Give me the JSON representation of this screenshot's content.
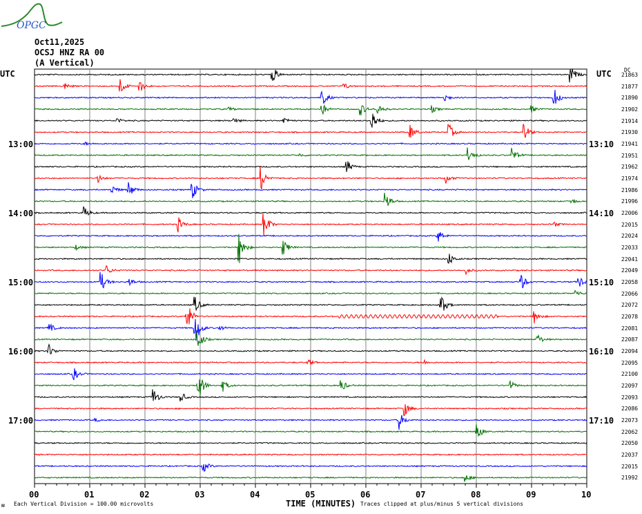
{
  "logo": {
    "text": "OPGC"
  },
  "header": {
    "date": "Oct11,2025",
    "station": "OCSJ HNZ RA 00",
    "component": "(A Vertical)"
  },
  "left_axis_label": "UTC",
  "right_axis_label": "UTC",
  "dc_header": "DC",
  "footer": {
    "scale_note": "Each Vertical Division =  100.00 microvolts",
    "xlabel": "TIME (MINUTES)",
    "clip_note": "Traces clipped at plus/minus 5 vertical divisions",
    "corner_mark": "ᴍ"
  },
  "colors": {
    "trace_cycle": [
      "#000000",
      "#ff0000",
      "#0000ff",
      "#007000"
    ],
    "grid": "#808080"
  },
  "chart_data": {
    "type": "line",
    "title": "OCSJ HNZ RA 00 (A Vertical) helicorder, Oct11,2025",
    "xlabel": "TIME (MINUTES)",
    "xlim": [
      0,
      10
    ],
    "x_ticks": [
      "00",
      "01",
      "02",
      "03",
      "04",
      "05",
      "06",
      "07",
      "08",
      "09",
      "10"
    ],
    "rows": 36,
    "row_minutes": 10,
    "left_hour_labels": [
      {
        "row": 6,
        "label": "13:00"
      },
      {
        "row": 12,
        "label": "14:00"
      },
      {
        "row": 18,
        "label": "15:00"
      },
      {
        "row": 24,
        "label": "16:00"
      },
      {
        "row": 30,
        "label": "17:00"
      }
    ],
    "right_hour_labels": [
      {
        "row": 6,
        "label": "13:10"
      },
      {
        "row": 12,
        "label": "14:10"
      },
      {
        "row": 18,
        "label": "15:10"
      },
      {
        "row": 24,
        "label": "16:10"
      },
      {
        "row": 30,
        "label": "17:10"
      }
    ],
    "dc_offsets": [
      "21863",
      "21877",
      "21890",
      "21902",
      "21914",
      "21930",
      "21941",
      "21951",
      "21962",
      "21974",
      "21986",
      "21996",
      "22006",
      "22015",
      "22024",
      "22033",
      "22041",
      "22049",
      "22058",
      "22066",
      "22072",
      "22078",
      "22081",
      "22087",
      "22094",
      "22095",
      "22100",
      "22097",
      "22093",
      "22086",
      "22073",
      "22062",
      "22050",
      "22037",
      "22015",
      "21992"
    ],
    "events": [
      [
        0,
        4.3,
        1.2
      ],
      [
        0,
        9.7,
        1.2
      ],
      [
        1,
        1.55,
        1
      ],
      [
        1,
        1.9,
        0.8
      ],
      [
        1,
        0.55,
        0.4
      ],
      [
        1,
        5.6,
        0.4
      ],
      [
        2,
        5.2,
        1.2
      ],
      [
        2,
        7.4,
        0.7
      ],
      [
        2,
        9.4,
        1.3
      ],
      [
        3,
        5.2,
        0.8
      ],
      [
        3,
        5.9,
        0.8
      ],
      [
        3,
        6.2,
        0.9
      ],
      [
        3,
        3.5,
        0.3
      ],
      [
        3,
        7.2,
        0.4
      ],
      [
        3,
        9.0,
        0.4
      ],
      [
        4,
        6.1,
        1.6
      ],
      [
        4,
        4.5,
        0.5
      ],
      [
        4,
        1.5,
        0.3
      ],
      [
        4,
        3.6,
        0.4
      ],
      [
        5,
        6.8,
        1
      ],
      [
        5,
        7.5,
        1.1
      ],
      [
        5,
        8.85,
        1.3
      ],
      [
        6,
        0.9,
        0.2
      ],
      [
        7,
        7.85,
        1
      ],
      [
        7,
        8.65,
        0.9
      ],
      [
        7,
        4.8,
        0.2
      ],
      [
        8,
        5.65,
        0.9
      ],
      [
        9,
        1.15,
        0.5
      ],
      [
        9,
        7.45,
        0.6
      ],
      [
        9,
        4.1,
        1.5
      ],
      [
        10,
        1.7,
        1
      ],
      [
        10,
        2.85,
        1.3
      ],
      [
        10,
        1.4,
        0.6
      ],
      [
        11,
        6.35,
        1.3
      ],
      [
        11,
        9.7,
        0.4
      ],
      [
        12,
        0.9,
        0.7
      ],
      [
        13,
        2.6,
        0.9
      ],
      [
        13,
        4.15,
        1.8
      ],
      [
        13,
        9.4,
        0.3
      ],
      [
        14,
        7.3,
        0.9
      ],
      [
        15,
        3.7,
        2.2
      ],
      [
        15,
        4.5,
        1.1
      ],
      [
        15,
        0.75,
        0.3
      ],
      [
        16,
        7.5,
        0.8
      ],
      [
        17,
        1.3,
        0.6
      ],
      [
        17,
        7.8,
        0.5
      ],
      [
        18,
        1.2,
        1.3
      ],
      [
        18,
        1.7,
        0.6
      ],
      [
        18,
        8.8,
        1.2
      ],
      [
        18,
        9.85,
        0.9
      ],
      [
        19,
        9.8,
        0.4
      ],
      [
        20,
        2.9,
        1.1
      ],
      [
        20,
        7.35,
        1.6
      ],
      [
        21,
        2.75,
        2.3
      ],
      [
        21,
        9.05,
        0.8
      ],
      [
        22,
        0.25,
        0.7
      ],
      [
        22,
        2.9,
        2.5
      ],
      [
        22,
        3.35,
        0.3
      ],
      [
        23,
        9.1,
        0.7
      ],
      [
        23,
        2.95,
        1.5
      ],
      [
        24,
        0.25,
        0.9
      ],
      [
        25,
        4.95,
        0.4
      ],
      [
        25,
        7.05,
        0.3
      ],
      [
        26,
        0.7,
        0.9
      ],
      [
        27,
        2.95,
        2.5
      ],
      [
        27,
        3.4,
        0.8
      ],
      [
        27,
        5.55,
        0.8
      ],
      [
        27,
        8.6,
        0.7
      ],
      [
        28,
        2.15,
        1.1
      ],
      [
        28,
        2.65,
        0.6
      ],
      [
        29,
        6.7,
        0.9
      ],
      [
        30,
        6.6,
        1.1
      ],
      [
        30,
        1.1,
        0.2
      ],
      [
        31,
        8.0,
        1.3
      ],
      [
        34,
        3.05,
        0.8
      ],
      [
        35,
        7.8,
        0.5
      ]
    ]
  }
}
